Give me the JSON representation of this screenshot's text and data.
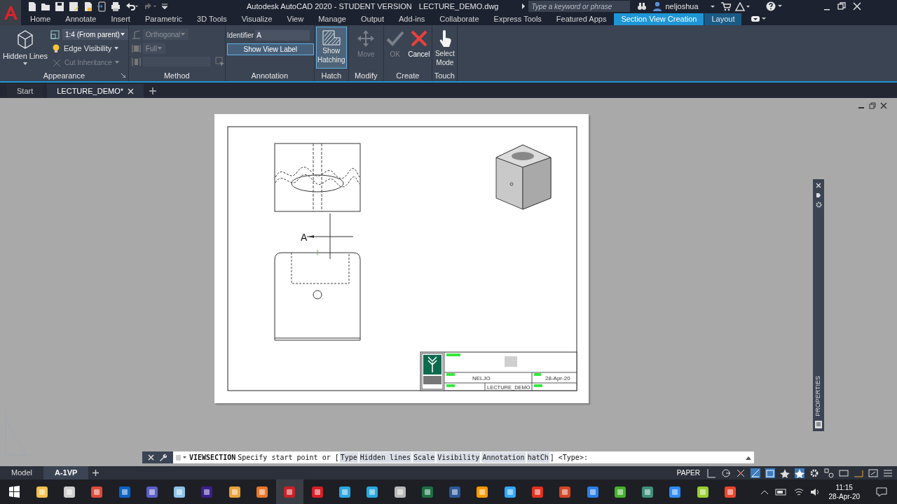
{
  "app_title": "Autodesk AutoCAD 2020 - STUDENT VERSION",
  "file_name": "LECTURE_DEMO.dwg",
  "search": {
    "placeholder": "Type a keyword or phrase"
  },
  "user": "neljoshua",
  "menu_tabs": [
    {
      "label": "Home",
      "selected": false,
      "kind": "normal"
    },
    {
      "label": "Annotate",
      "selected": false,
      "kind": "normal"
    },
    {
      "label": "Insert",
      "selected": false,
      "kind": "normal"
    },
    {
      "label": "Parametric",
      "selected": false,
      "kind": "normal"
    },
    {
      "label": "3D Tools",
      "selected": false,
      "kind": "normal"
    },
    {
      "label": "Visualize",
      "selected": false,
      "kind": "normal"
    },
    {
      "label": "View",
      "selected": false,
      "kind": "normal"
    },
    {
      "label": "Manage",
      "selected": false,
      "kind": "normal"
    },
    {
      "label": "Output",
      "selected": false,
      "kind": "normal"
    },
    {
      "label": "Add-ins",
      "selected": false,
      "kind": "normal"
    },
    {
      "label": "Collaborate",
      "selected": false,
      "kind": "normal"
    },
    {
      "label": "Express Tools",
      "selected": false,
      "kind": "normal"
    },
    {
      "label": "Featured Apps",
      "selected": false,
      "kind": "normal"
    },
    {
      "label": "Section View Creation",
      "selected": true,
      "kind": "contextual"
    },
    {
      "label": "Layout",
      "selected": false,
      "kind": "contextual"
    }
  ],
  "ribbon": {
    "appearance": {
      "title": "Appearance",
      "hidden_lines": "Hidden Lines",
      "scale": "1:4 (From parent)",
      "edge_visibility": "Edge Visibility",
      "cut_inheritance": {
        "label": "Cut Inheritance",
        "disabled": true
      }
    },
    "method": {
      "title": "Method",
      "projection": "Orthogonal",
      "depth": "Full",
      "disabled": true
    },
    "annotation": {
      "title": "Annotation",
      "identifier_label": "Identifier",
      "identifier": "A",
      "show_view_label": {
        "label": "Show View Label",
        "on": true
      }
    },
    "hatch": {
      "title": "Hatch",
      "show_hatching": {
        "label": "Show Hatching",
        "on": true
      }
    },
    "modify": {
      "title": "Modify",
      "move": {
        "label": "Move",
        "disabled": true
      }
    },
    "create": {
      "title": "Create",
      "ok": {
        "label": "OK",
        "disabled": true
      },
      "cancel": {
        "label": "Cancel",
        "disabled": false
      }
    },
    "touch": {
      "title": "Touch",
      "select_mode": "Select Mode"
    }
  },
  "doc_tabs": [
    {
      "label": "Start",
      "selected": false
    },
    {
      "label": "LECTURE_DEMO*",
      "selected": true
    }
  ],
  "drawing": {
    "section_label": "A",
    "title_block": {
      "drawn_by": "NELJO",
      "date": "28-Apr-20",
      "drawing_name": "LECTURE_DEMO"
    }
  },
  "properties_palette": {
    "title": "PROPERTIES"
  },
  "command_line": {
    "command": "VIEWSECTION",
    "prompt_start": "Specify start point or [",
    "options": [
      "Type",
      "Hidden lines",
      "Scale",
      "Visibility",
      "Annotation",
      "hatCh"
    ],
    "prompt_end": "] <Type>:"
  },
  "layout_tabs": [
    {
      "label": "Model",
      "selected": false
    },
    {
      "label": "A-1VP",
      "selected": true
    }
  ],
  "status_bar": {
    "space": "PAPER"
  },
  "taskbar": {
    "time": "11:15",
    "date": "28-Apr-20"
  }
}
